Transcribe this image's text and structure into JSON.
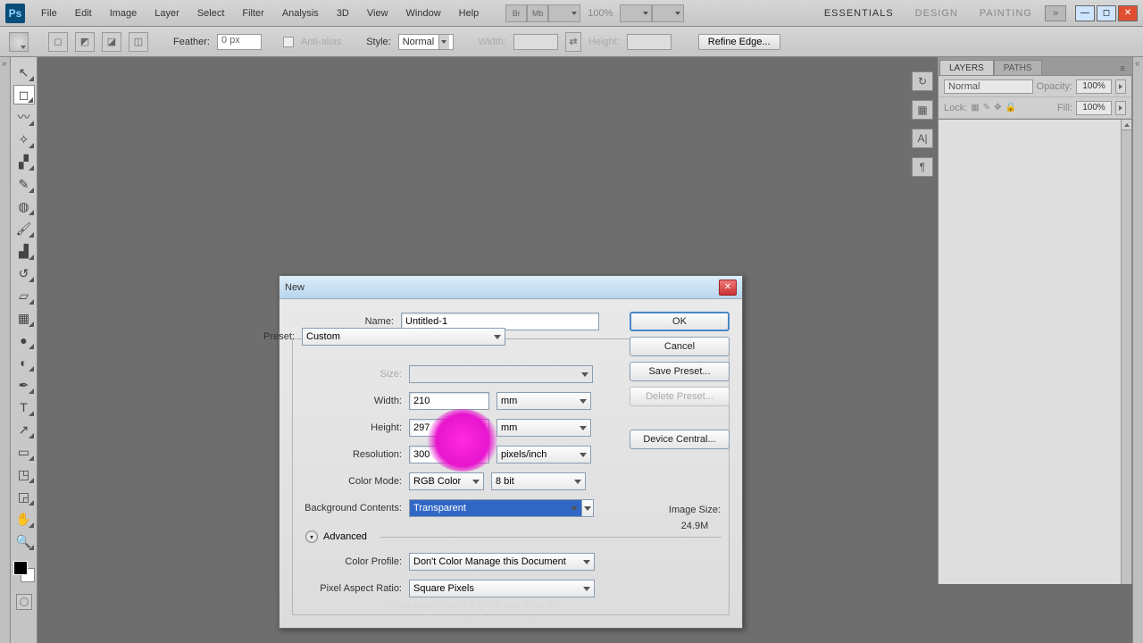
{
  "menubar": {
    "items": [
      "File",
      "Edit",
      "Image",
      "Layer",
      "Select",
      "Filter",
      "Analysis",
      "3D",
      "View",
      "Window",
      "Help"
    ],
    "toggles": [
      "Br",
      "Mb"
    ],
    "zoom": "100%",
    "workspaces": [
      "ESSENTIALS",
      "DESIGN",
      "PAINTING"
    ]
  },
  "optbar": {
    "feather_label": "Feather:",
    "feather_value": "0 px",
    "antialias_label": "Anti-alias",
    "style_label": "Style:",
    "style_value": "Normal",
    "width_label": "Width:",
    "height_label": "Height:",
    "refine_label": "Refine Edge..."
  },
  "tools": {
    "items": [
      {
        "name": "move-tool",
        "glyph": "↖"
      },
      {
        "name": "marquee-tool",
        "glyph": "◻",
        "active": true
      },
      {
        "name": "lasso-tool",
        "glyph": "〰"
      },
      {
        "name": "magic-wand-tool",
        "glyph": "✧"
      },
      {
        "name": "crop-tool",
        "glyph": "▞"
      },
      {
        "name": "eyedropper-tool",
        "glyph": "✎"
      },
      {
        "name": "healing-brush-tool",
        "glyph": "◍"
      },
      {
        "name": "brush-tool",
        "glyph": "🖌"
      },
      {
        "name": "clone-stamp-tool",
        "glyph": "▟"
      },
      {
        "name": "history-brush-tool",
        "glyph": "↺"
      },
      {
        "name": "eraser-tool",
        "glyph": "▱"
      },
      {
        "name": "gradient-tool",
        "glyph": "▦"
      },
      {
        "name": "blur-tool",
        "glyph": "●"
      },
      {
        "name": "dodge-tool",
        "glyph": "◐"
      },
      {
        "name": "pen-tool",
        "glyph": "✒"
      },
      {
        "name": "type-tool",
        "glyph": "T"
      },
      {
        "name": "path-select-tool",
        "glyph": "↗"
      },
      {
        "name": "shape-tool",
        "glyph": "▭"
      },
      {
        "name": "3d-tool",
        "glyph": "◳"
      },
      {
        "name": "3d-camera-tool",
        "glyph": "◲"
      },
      {
        "name": "hand-tool",
        "glyph": "✋"
      },
      {
        "name": "zoom-tool",
        "glyph": "🔍"
      }
    ]
  },
  "right_dock": {
    "icons": [
      {
        "name": "history-icon",
        "glyph": "↻"
      },
      {
        "name": "swatches-icon",
        "glyph": "▦"
      },
      {
        "name": "character-icon",
        "glyph": "A|"
      },
      {
        "name": "paragraph-icon",
        "glyph": "¶"
      }
    ]
  },
  "layers_panel": {
    "tabs": [
      "LAYERS",
      "PATHS"
    ],
    "blend_mode": "Normal",
    "opacity_label": "Opacity:",
    "opacity_value": "100%",
    "lock_label": "Lock:",
    "fill_label": "Fill:",
    "fill_value": "100%"
  },
  "dialog": {
    "title": "New",
    "labels": {
      "name": "Name:",
      "preset": "Preset:",
      "size": "Size:",
      "width": "Width:",
      "height": "Height:",
      "resolution": "Resolution:",
      "color_mode": "Color Mode:",
      "background": "Background Contents:",
      "advanced": "Advanced",
      "color_profile": "Color Profile:",
      "pixel_aspect": "Pixel Aspect Ratio:",
      "image_size": "Image Size:"
    },
    "values": {
      "name": "Untitled-1",
      "preset": "Custom",
      "size": "",
      "width": "210",
      "width_unit": "mm",
      "height": "297",
      "height_unit": "mm",
      "resolution": "300",
      "resolution_unit": "pixels/inch",
      "color_mode": "RGB Color",
      "bit_depth": "8 bit",
      "background": "Transparent",
      "color_profile": "Don't Color Manage this Document",
      "pixel_aspect": "Square Pixels",
      "image_size": "24.9M"
    },
    "buttons": {
      "ok": "OK",
      "cancel": "Cancel",
      "save_preset": "Save Preset...",
      "delete_preset": "Delete Preset...",
      "device_central": "Device Central..."
    }
  },
  "caption": {
    "line1": "If you want to print it in the end, then it's",
    "line2": "best if the resolution is 300 dpi."
  }
}
